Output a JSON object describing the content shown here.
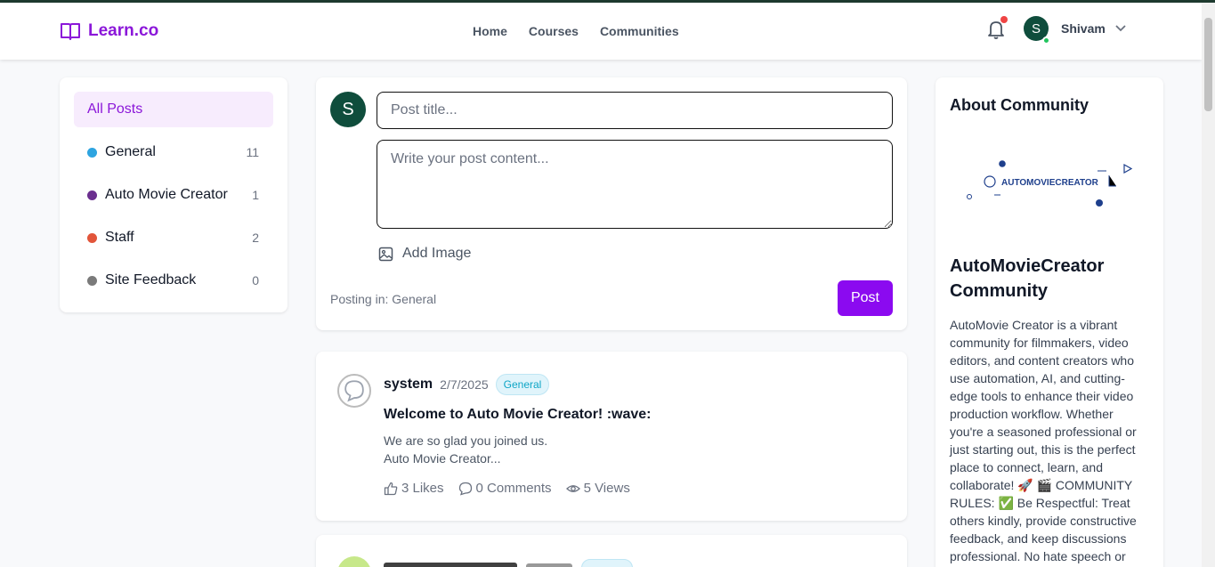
{
  "brand": {
    "name": "Learn.co",
    "accent": "#8b17d9"
  },
  "nav": {
    "items": [
      "Home",
      "Courses",
      "Communities"
    ]
  },
  "user": {
    "initial": "S",
    "name": "Shivam"
  },
  "sidebar": {
    "active": "All Posts",
    "categories": [
      {
        "label": "General",
        "count": "11",
        "color": "#2ea4e0"
      },
      {
        "label": "Auto Movie Creator",
        "count": "1",
        "color": "#6b2f8f"
      },
      {
        "label": "Staff",
        "count": "2",
        "color": "#e2553a"
      },
      {
        "label": "Site Feedback",
        "count": "0",
        "color": "#7a7a7a"
      }
    ]
  },
  "composer": {
    "avatar_initial": "S",
    "title_placeholder": "Post title...",
    "content_placeholder": "Write your post content...",
    "add_image": "Add Image",
    "posting_in": "Posting in: General",
    "post_button": "Post"
  },
  "posts": [
    {
      "author": "system",
      "date": "2/7/2025",
      "tag": "General",
      "title": "Welcome to Auto Movie Creator! :wave:",
      "body_line1": "We are so glad you joined us.",
      "body_line2": "Auto Movie Creator...",
      "likes": "3 Likes",
      "comments": "0 Comments",
      "views": "5 Views"
    }
  ],
  "about": {
    "heading": "About Community",
    "logo_text": "AUTOMOVIECREATOR",
    "community_name": "AutoMovieCreator Community",
    "description": "AutoMovie Creator is a vibrant community for filmmakers, video editors, and content creators who use automation, AI, and cutting-edge tools to enhance their video production workflow. Whether you're a seasoned professional or just starting out, this is the perfect place to connect, learn, and collaborate! 🚀 🎬 COMMUNITY RULES: ✅ Be Respectful: Treat others kindly, provide constructive feedback, and keep discussions professional. No hate speech or"
  }
}
